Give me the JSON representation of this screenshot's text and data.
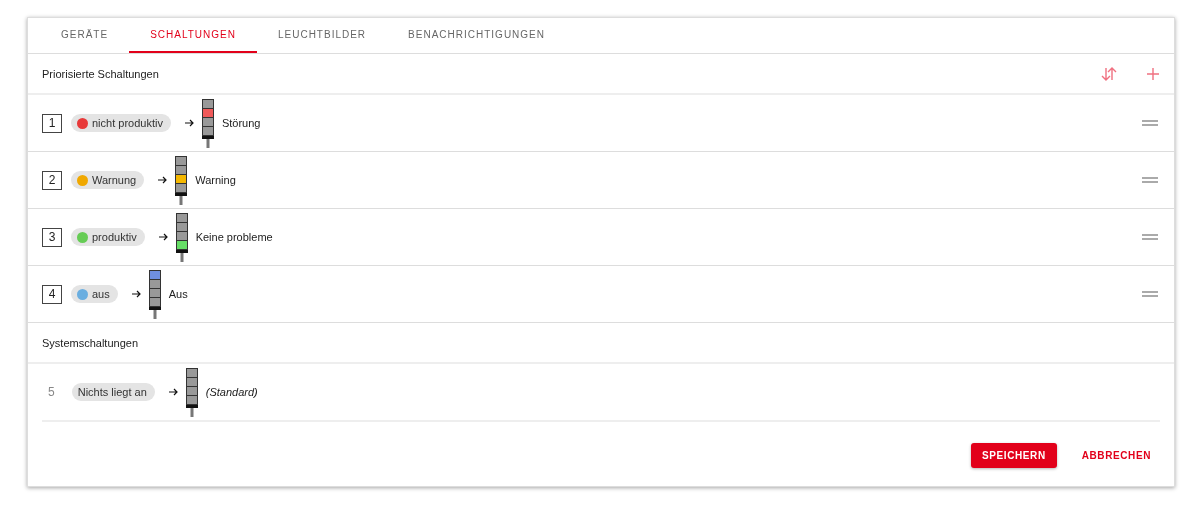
{
  "tabs": [
    {
      "label": "GERÄTE",
      "selected": false
    },
    {
      "label": "SCHALTUNGEN",
      "selected": true
    },
    {
      "label": "LEUCHTBILDER",
      "selected": false
    },
    {
      "label": "BENACHRICHTIGUNGEN",
      "selected": false
    }
  ],
  "sections": [
    {
      "title": "Priorisierte Schaltungen",
      "actions": true,
      "rows": [
        {
          "kind": "priority",
          "number": "1",
          "state": {
            "label": "nicht produktiv",
            "color": "#e83a3a"
          },
          "lamps": [
            {
              "on": false
            },
            {
              "on": true,
              "color": "#f05a5a"
            },
            {
              "on": false
            },
            {
              "on": false
            }
          ],
          "result": "Störung",
          "italic": false
        },
        {
          "kind": "priority",
          "number": "2",
          "state": {
            "label": "Warnung",
            "color": "#f0a800"
          },
          "lamps": [
            {
              "on": false
            },
            {
              "on": false
            },
            {
              "on": true,
              "color": "#f5b800"
            },
            {
              "on": false
            }
          ],
          "result": "Warning",
          "italic": false
        },
        {
          "kind": "priority",
          "number": "3",
          "state": {
            "label": "produktiv",
            "color": "#66cc55"
          },
          "lamps": [
            {
              "on": false
            },
            {
              "on": false
            },
            {
              "on": false
            },
            {
              "on": true,
              "color": "#66dd66"
            }
          ],
          "result": "Keine probleme",
          "italic": false
        },
        {
          "kind": "priority",
          "number": "4",
          "state": {
            "label": "aus",
            "color": "#6aaee0"
          },
          "lamps": [
            {
              "on": true,
              "color": "#6f8fe0"
            },
            {
              "on": false
            },
            {
              "on": false
            },
            {
              "on": false
            }
          ],
          "result": "Aus",
          "italic": false
        }
      ]
    },
    {
      "title": "Systemschaltungen",
      "actions": false,
      "rows": [
        {
          "kind": "system",
          "number": "5",
          "state": {
            "label": "Nichts liegt an"
          },
          "lamps": [
            {
              "on": false
            },
            {
              "on": false
            },
            {
              "on": false
            },
            {
              "on": false
            }
          ],
          "result": "(Standard)",
          "italic": true
        }
      ]
    }
  ],
  "buttons": [
    {
      "label": "SPEICHERN",
      "kind": "primary"
    },
    {
      "label": "ABBRECHEN",
      "kind": "text"
    }
  ]
}
